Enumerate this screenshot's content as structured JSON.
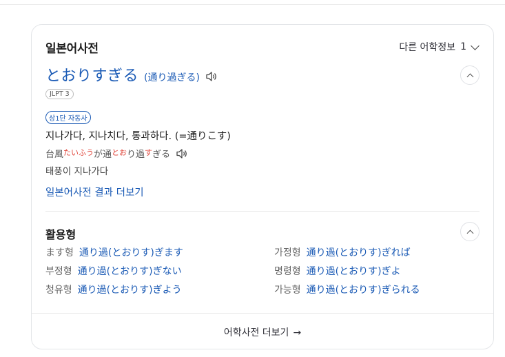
{
  "card": {
    "title": "일본어사전",
    "more_info_label": "다른 어학정보",
    "more_info_count": "1"
  },
  "entry": {
    "headword": "とおりすぎる",
    "kanji": "(通り過ぎる)",
    "jlpt": "JLPT 3",
    "pos": "상1단 자동사",
    "meaning": "지나가다, 지나치다, 통과하다. (=通りこす)",
    "example": {
      "parts": [
        {
          "text": "台風",
          "style": "normal"
        },
        {
          "text": "たいふう",
          "style": "ruby"
        },
        {
          "text": "が通",
          "style": "normal"
        },
        {
          "text": "とお",
          "style": "ruby"
        },
        {
          "text": "り過",
          "style": "normal"
        },
        {
          "text": "す",
          "style": "ruby"
        },
        {
          "text": "ぎる",
          "style": "normal"
        }
      ],
      "translation": "태풍이 지나가다"
    },
    "more_link": "일본어사전 결과 더보기"
  },
  "conjugation": {
    "title": "활용형",
    "items": [
      {
        "label": "ます형",
        "value": "通り過(とおりす)ぎます"
      },
      {
        "label": "가정형",
        "value": "通り過(とおりす)ぎれば"
      },
      {
        "label": "부정형",
        "value": "通り過(とおりす)ぎない"
      },
      {
        "label": "명령형",
        "value": "通り過(とおりす)ぎよ"
      },
      {
        "label": "청유형",
        "value": "通り過(とおりす)ぎよう"
      },
      {
        "label": "가능형",
        "value": "通り過(とおりす)ぎられる"
      }
    ]
  },
  "footer": {
    "label": "어학사전 더보기",
    "arrow": "→"
  },
  "icons": {
    "speaker": "speaker-icon",
    "collapse": "chevron-up-icon",
    "expand": "chevron-down-icon"
  },
  "colors": {
    "link_blue": "#1a5ab5",
    "ruby_red": "#e0453a"
  }
}
